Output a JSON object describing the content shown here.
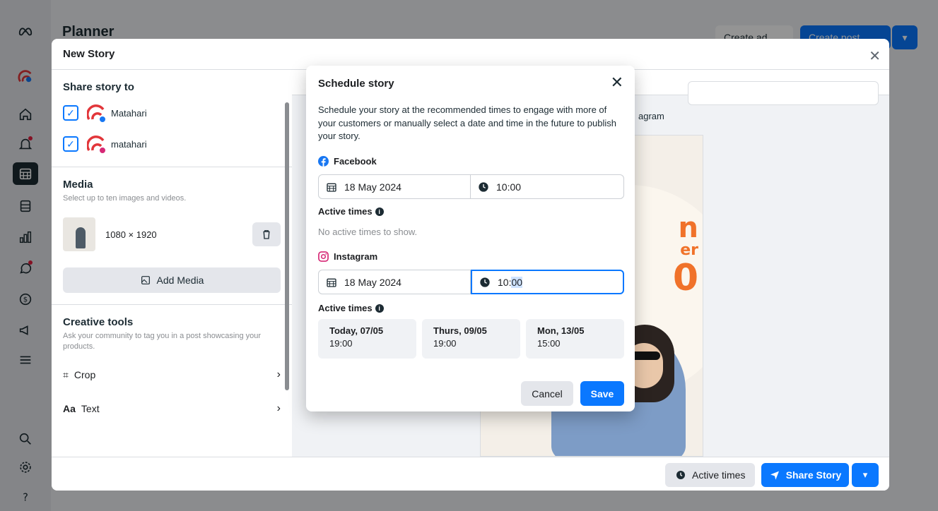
{
  "background": {
    "planner_title": "Planner",
    "create_ad_label": "Create ad",
    "create_post_label": "Create post"
  },
  "story_modal": {
    "title": "New Story",
    "share_to": {
      "title": "Share story to",
      "accounts": [
        {
          "name": "Matahari",
          "platform": "facebook",
          "checked": true
        },
        {
          "name": "matahari",
          "platform": "instagram",
          "checked": true
        }
      ]
    },
    "media": {
      "title": "Media",
      "subtitle": "Select up to ten images and videos.",
      "item_size": "1080 × 1920",
      "add_label": "Add Media"
    },
    "creative_tools": {
      "title": "Creative tools",
      "subtitle": "Ask your community to tag you in a post showcasing your products.",
      "items": [
        {
          "label": "Crop",
          "icon": "crop-icon"
        },
        {
          "label": "Text",
          "icon": "text-icon"
        }
      ]
    },
    "preview_partial_label": "agram",
    "footer": {
      "active_times_label": "Active times",
      "share_label": "Share Story"
    }
  },
  "schedule_dialog": {
    "title": "Schedule story",
    "description": "Schedule your story at the recommended times to engage with more of your customers or manually select a date and time in the future to publish your story.",
    "facebook": {
      "label": "Facebook",
      "date": "18 May 2024",
      "hour": "10",
      "minute": "00",
      "active_times_label": "Active times",
      "empty_text": "No active times to show."
    },
    "instagram": {
      "label": "Instagram",
      "date": "18 May 2024",
      "hour": "10",
      "minute": "00",
      "active_times_label": "Active times",
      "times": [
        {
          "day": "Today, 07/05",
          "time": "19:00"
        },
        {
          "day": "Thurs, 09/05",
          "time": "19:00"
        },
        {
          "day": "Mon, 13/05",
          "time": "15:00"
        }
      ]
    },
    "cancel_label": "Cancel",
    "save_label": "Save"
  },
  "colors": {
    "accent": "#0a78ff",
    "rail": "#e4e6eb",
    "brand_red": "#e2363a"
  }
}
